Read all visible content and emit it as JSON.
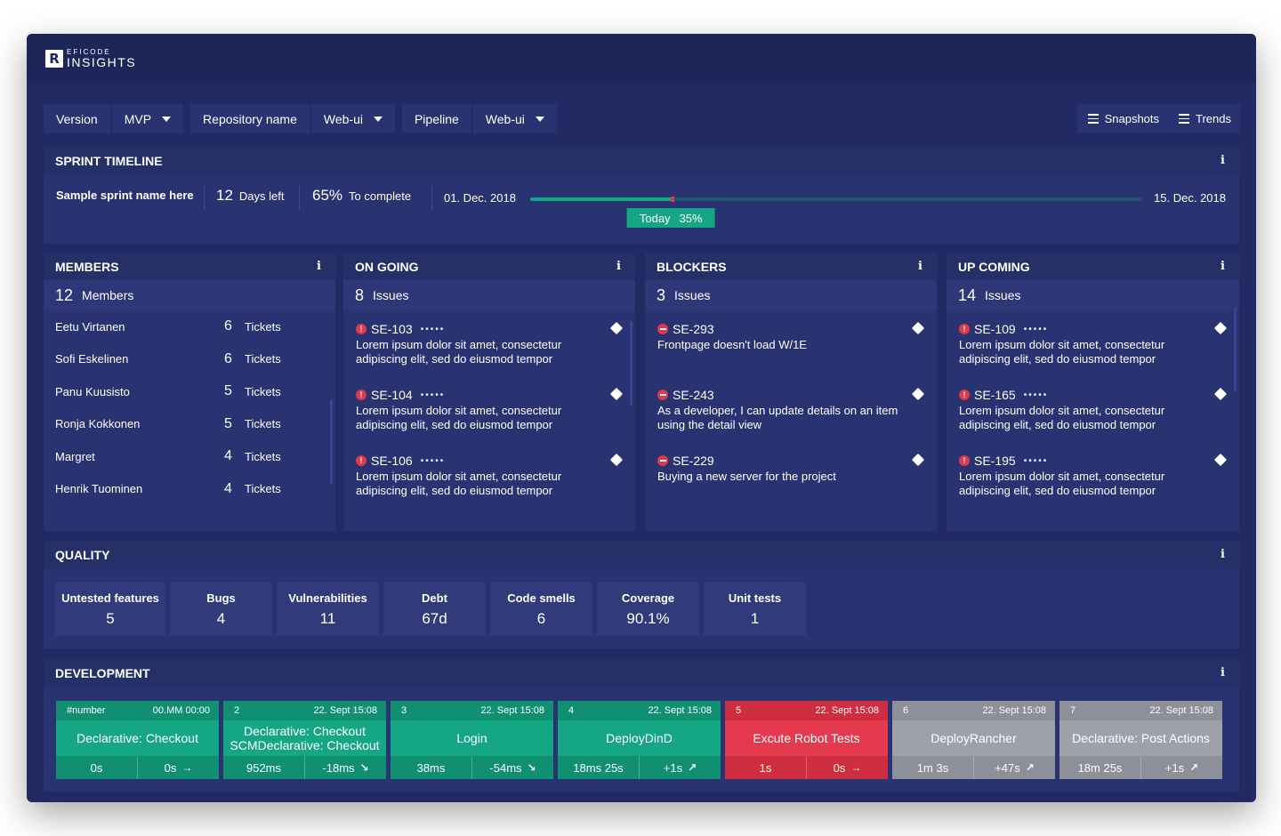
{
  "brand": {
    "mark": "R",
    "small": "EFICODE",
    "big": "INSIGHTS"
  },
  "filters": [
    {
      "label": "Version",
      "value": "MVP"
    },
    {
      "label": "Repository name",
      "value": "Web-ui"
    },
    {
      "label": "Pipeline",
      "value": "Web-ui"
    }
  ],
  "actions": {
    "snapshots": "Snapshots",
    "trends": "Trends"
  },
  "info_icon": "i",
  "sprint": {
    "title": "SPRINT TIMELINE",
    "name": "Sample sprint name here",
    "days_left": "12",
    "days_left_label": "Days left",
    "complete": "65%",
    "complete_label": "To complete",
    "start_date": "01. Dec. 2018",
    "end_date": "15. Dec. 2018",
    "today_label": "Today",
    "today_value": "35%",
    "progress_fraction": 0.235,
    "today_fraction": 0.23
  },
  "members": {
    "title": "MEMBERS",
    "count": "12",
    "count_label": "Members",
    "ticket_label": "Tickets",
    "items": [
      {
        "name": "Eetu Virtanen",
        "tickets": "6"
      },
      {
        "name": "Sofi Eskelinen",
        "tickets": "6"
      },
      {
        "name": "Panu Kuusisto",
        "tickets": "5"
      },
      {
        "name": "Ronja Kokkonen",
        "tickets": "5"
      },
      {
        "name": "Margret",
        "tickets": "4"
      },
      {
        "name": "Henrik Tuominen",
        "tickets": "4"
      }
    ]
  },
  "ongoing": {
    "title": "ON GOING",
    "count": "8",
    "count_label": "Issues",
    "items": [
      {
        "id": "SE-103",
        "dots": "•••••",
        "desc": "Lorem ipsum dolor sit amet, consectetur adipiscing elit, sed do eiusmod tempor"
      },
      {
        "id": "SE-104",
        "dots": "•••••",
        "desc": "Lorem ipsum dolor sit amet, consectetur adipiscing elit, sed do eiusmod tempor"
      },
      {
        "id": "SE-106",
        "dots": "•••••",
        "desc": "Lorem ipsum dolor sit amet, consectetur adipiscing elit, sed do eiusmod tempor"
      }
    ]
  },
  "blockers": {
    "title": "BLOCKERS",
    "count": "3",
    "count_label": "Issues",
    "items": [
      {
        "id": "SE-293",
        "desc": "Frontpage doesn't load W/1E"
      },
      {
        "id": "SE-243",
        "desc": "As a developer, I can update details on an item using the detail view"
      },
      {
        "id": "SE-229",
        "desc": "Buying a new server for the project"
      }
    ]
  },
  "upcoming": {
    "title": "UP COMING",
    "count": "14",
    "count_label": "Issues",
    "items": [
      {
        "id": "SE-109",
        "dots": "•••••",
        "desc": "Lorem ipsum dolor sit amet, consectetur adipiscing elit, sed do eiusmod tempor"
      },
      {
        "id": "SE-165",
        "dots": "•••••",
        "desc": "Lorem ipsum dolor sit amet, consectetur adipiscing elit, sed do eiusmod tempor"
      },
      {
        "id": "SE-195",
        "dots": "•••••",
        "desc": "Lorem ipsum dolor sit amet, consectetur adipiscing elit, sed do eiusmod tempor"
      }
    ]
  },
  "quality": {
    "title": "QUALITY",
    "metrics": [
      {
        "label": "Untested features",
        "value": "5"
      },
      {
        "label": "Bugs",
        "value": "4"
      },
      {
        "label": "Vulnerabilities",
        "value": "11"
      },
      {
        "label": "Debt",
        "value": "67d"
      },
      {
        "label": "Code smells",
        "value": "6"
      },
      {
        "label": "Coverage",
        "value": "90.1%"
      },
      {
        "label": "Unit tests",
        "value": "1"
      }
    ]
  },
  "development": {
    "title": "DEVELOPMENT",
    "stages": [
      {
        "num": "#number",
        "time": "00.MM 00:00",
        "name": "Declarative: Checkout",
        "duration": "0s",
        "delta": "0s",
        "trend": "→",
        "status": "green"
      },
      {
        "num": "2",
        "time": "22. Sept 15:08",
        "name": "Declarative: Checkout SCMDeclarative: Checkout",
        "duration": "952ms",
        "delta": "-18ms",
        "trend": "↘",
        "status": "green"
      },
      {
        "num": "3",
        "time": "22. Sept 15:08",
        "name": "Login",
        "duration": "38ms",
        "delta": "-54ms",
        "trend": "↘",
        "status": "green"
      },
      {
        "num": "4",
        "time": "22. Sept 15:08",
        "name": "DeployDinD",
        "duration": "18ms 25s",
        "delta": "+1s",
        "trend": "↗",
        "status": "green"
      },
      {
        "num": "5",
        "time": "22. Sept 15:08",
        "name": "Excute Robot Tests",
        "duration": "1s",
        "delta": "0s",
        "trend": "→",
        "status": "red"
      },
      {
        "num": "6",
        "time": "22. Sept 15:08",
        "name": "DeployRancher",
        "duration": "1m 3s",
        "delta": "+47s",
        "trend": "↗",
        "status": "grey"
      },
      {
        "num": "7",
        "time": "22. Sept 15:08",
        "name": "Declarative: Post Actions",
        "duration": "18m 25s",
        "delta": "+1s",
        "trend": "↗",
        "status": "grey"
      }
    ]
  }
}
